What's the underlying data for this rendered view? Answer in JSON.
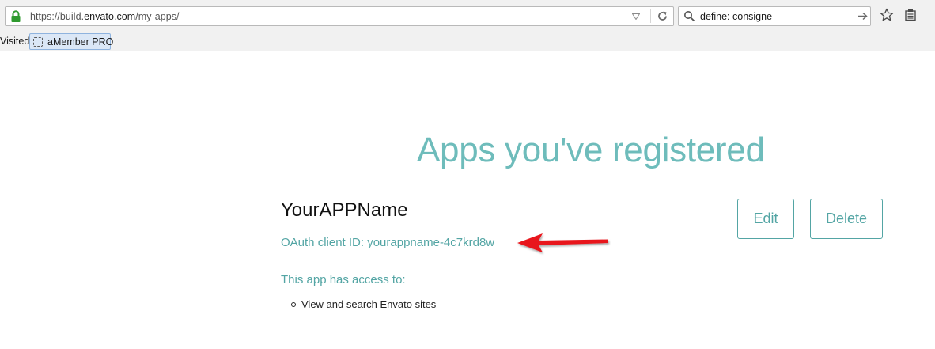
{
  "browser": {
    "url_prefix": "https://build.",
    "url_domain": "envato.com",
    "url_path": "/my-apps/",
    "search_value": "define: consigne",
    "icons": [
      "lock-icon",
      "dropdown-arrow-icon",
      "reload-icon",
      "search-icon",
      "go-arrow-icon",
      "star-icon",
      "bookmarks-icon"
    ]
  },
  "bookmarks": {
    "visited_label": "Visited",
    "items": [
      {
        "label": "aMember PRO",
        "icon": "folder-icon"
      }
    ]
  },
  "page": {
    "title": "Apps you've registered",
    "app": {
      "name": "YourAPPName",
      "client_id_text": "OAuth client ID: yourappname-4c7krd8w",
      "access_heading": "This app has access to:",
      "permissions": [
        "View and search Envato sites"
      ],
      "edit_label": "Edit",
      "delete_label": "Delete"
    }
  },
  "colors": {
    "accent": "#53a5a4",
    "title": "#6ebcbb",
    "annotation_arrow": "#e8141b"
  }
}
